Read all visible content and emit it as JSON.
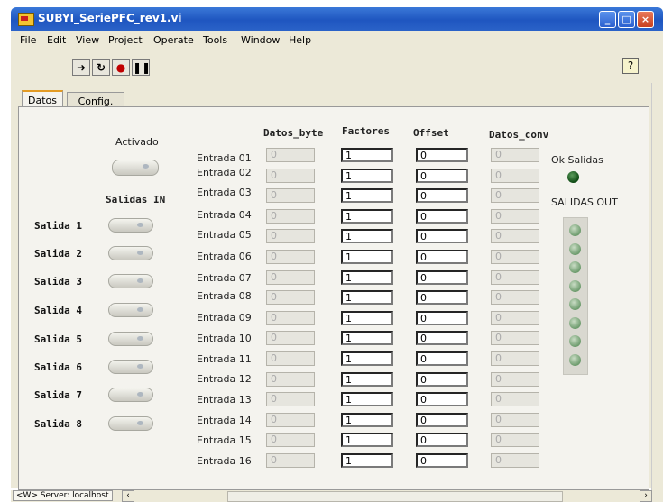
{
  "window": {
    "title": "SUBYI_SeriePFC_rev1.vi"
  },
  "menu": [
    "File",
    "Edit",
    "View",
    "Project",
    "Operate",
    "Tools",
    "Window",
    "Help"
  ],
  "toolbar": {
    "help": "?"
  },
  "tabs": [
    "Datos",
    "Config."
  ],
  "panel": {
    "activado_label": "Activado",
    "salidas_in_label": "Salidas IN",
    "salidas": [
      "Salida 1",
      "Salida 2",
      "Salida 3",
      "Salida 4",
      "Salida 5",
      "Salida 6",
      "Salida 7",
      "Salida 8"
    ],
    "entradas": [
      "Entrada 01",
      "Entrada 02",
      "Entrada 03",
      "Entrada 04",
      "Entrada 05",
      "Entrada 06",
      "Entrada 07",
      "Entrada 08",
      "Entrada 09",
      "Entrada 10",
      "Entrada 11",
      "Entrada 12",
      "Entrada 13",
      "Entrada 14",
      "Entrada 15",
      "Entrada 16"
    ],
    "headers": {
      "datos_byte": "Datos_byte",
      "factores": "Factores",
      "offset": "Offset",
      "datos_conv": "Datos_conv"
    },
    "datos_byte": [
      "0",
      "0",
      "0",
      "0",
      "0",
      "0",
      "0",
      "0",
      "0",
      "0",
      "0",
      "0",
      "0",
      "0",
      "0",
      "0"
    ],
    "factores": [
      "1",
      "1",
      "1",
      "1",
      "1",
      "1",
      "1",
      "1",
      "1",
      "1",
      "1",
      "1",
      "1",
      "1",
      "1",
      "1"
    ],
    "offset": [
      "0",
      "0",
      "0",
      "0",
      "0",
      "0",
      "0",
      "0",
      "0",
      "0",
      "0",
      "0",
      "0",
      "0",
      "0",
      "0"
    ],
    "datos_conv": [
      "0",
      "0",
      "0",
      "0",
      "0",
      "0",
      "0",
      "0",
      "0",
      "0",
      "0",
      "0",
      "0",
      "0",
      "0",
      "0"
    ],
    "ok_salidas_label": "Ok Salidas",
    "salidas_out_label": "SALIDAS OUT"
  },
  "status": {
    "server": "<W> Server: localhost"
  }
}
